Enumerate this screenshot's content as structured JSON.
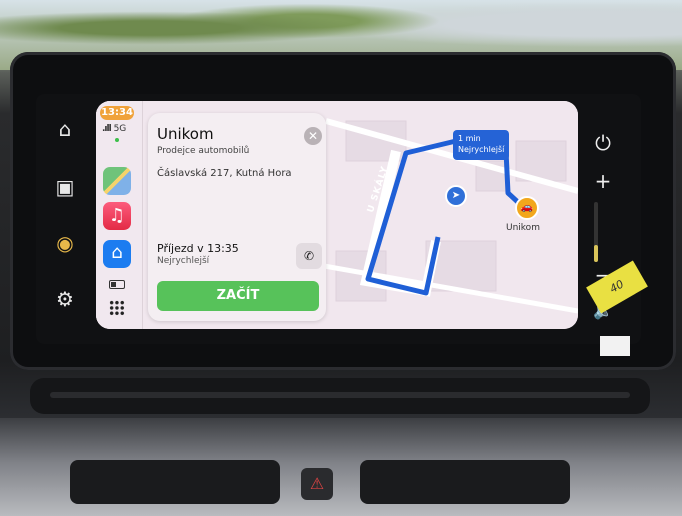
{
  "status": {
    "time": "13:34",
    "network": "5G"
  },
  "destination_card": {
    "title": "Unikom",
    "subtitle": "Prodejce automobilů",
    "address": "Čáslavská 217, Kutná Hora",
    "arrival": "Příjezd v 13:35",
    "route_type": "Nejrychlejší",
    "start_label": "ZAČÍT"
  },
  "map": {
    "route_time": "1 min",
    "route_label": "Nejrychlejší",
    "street_name": "U SKÁLY",
    "destination_label": "Unikom",
    "route_color": "#2563d6"
  },
  "dock_apps": [
    "maps-icon",
    "music-icon",
    "home-icon"
  ],
  "sticker_text": "40",
  "colors": {
    "start_button": "#57c25a",
    "time_pill": "#f0a23a",
    "accent": "#2563d6"
  }
}
